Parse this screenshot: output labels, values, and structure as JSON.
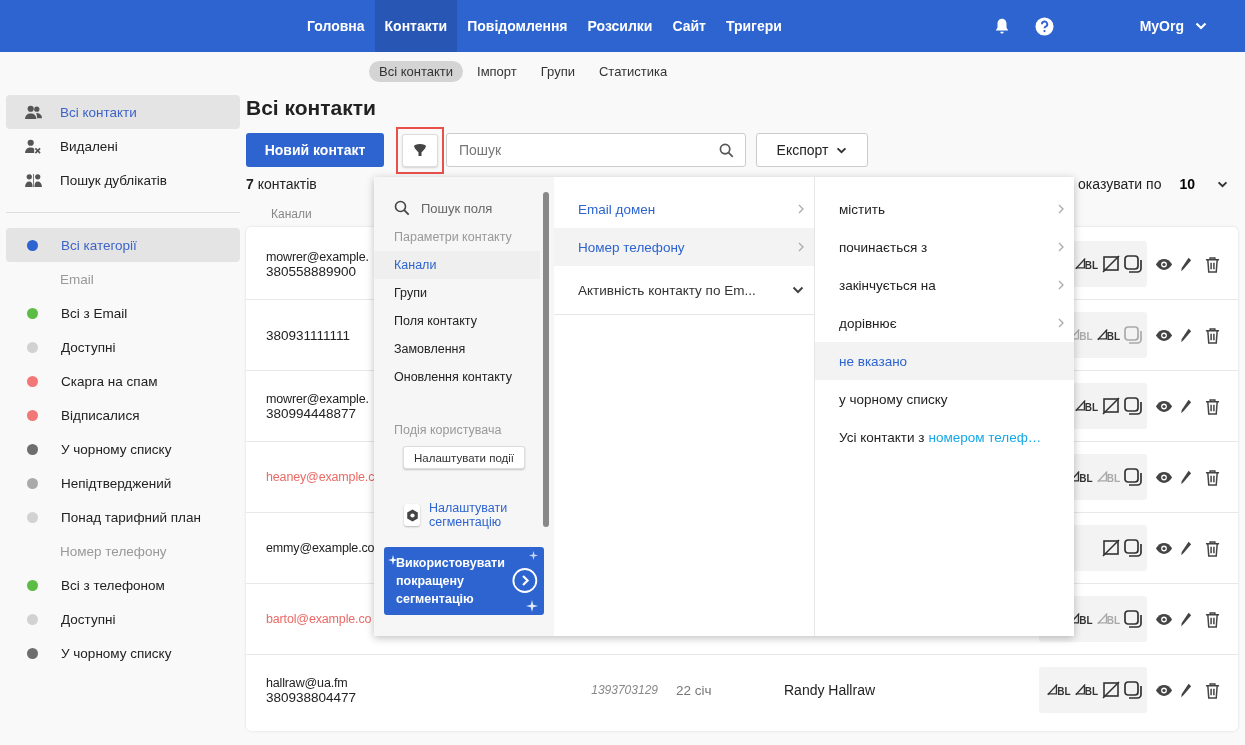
{
  "nav": {
    "items": [
      {
        "label": "Головна",
        "selected": false
      },
      {
        "label": "Контакти",
        "selected": true
      },
      {
        "label": "Повідомлення",
        "selected": false
      },
      {
        "label": "Розсилки",
        "selected": false
      },
      {
        "label": "Сайт",
        "selected": false
      },
      {
        "label": "Тригери",
        "selected": false
      }
    ],
    "org": "MyOrg"
  },
  "subnav": [
    {
      "label": "Всі контакти",
      "selected": true
    },
    {
      "label": "Імпорт",
      "selected": false
    },
    {
      "label": "Групи",
      "selected": false
    },
    {
      "label": "Статистика",
      "selected": false
    }
  ],
  "sidebar": {
    "items": [
      {
        "kind": "people",
        "label": "Всі контакти",
        "selected": true
      },
      {
        "kind": "deleted",
        "label": "Видалені",
        "selected": false
      },
      {
        "kind": "duplicates",
        "label": "Пошук дублікатів",
        "selected": false
      }
    ],
    "categories": [
      {
        "kind": "category",
        "label": "Всі категорії",
        "color": "#2d64cf",
        "selected": true
      },
      {
        "kind": "heading",
        "label": "Email"
      },
      {
        "kind": "category",
        "label": "Всі з Email",
        "color": "#5bbd45",
        "selected": false
      },
      {
        "kind": "category",
        "label": "Доступні",
        "color": "#d2d2d2",
        "selected": false
      },
      {
        "kind": "category",
        "label": "Скарга на спам",
        "color": "#f27777",
        "selected": false
      },
      {
        "kind": "category",
        "label": "Відписалися",
        "color": "#f27777",
        "selected": false
      },
      {
        "kind": "category",
        "label": "У чорному списку",
        "color": "#6e6e6e",
        "selected": false
      },
      {
        "kind": "category",
        "label": "Непідтверджений",
        "color": "#aaaaaa",
        "selected": false
      },
      {
        "kind": "category",
        "label": "Понад тарифний план",
        "color": "#d2d2d2",
        "selected": false
      },
      {
        "kind": "heading",
        "label": "Номер телефону"
      },
      {
        "kind": "category",
        "label": "Всі з телефоном",
        "color": "#5bbd45",
        "selected": false
      },
      {
        "kind": "category",
        "label": "Доступні",
        "color": "#d2d2d2",
        "selected": false
      },
      {
        "kind": "category",
        "label": "У чорному списку",
        "color": "#6e6e6e",
        "selected": false
      }
    ]
  },
  "page": {
    "title": "Всі контакти",
    "new_button": "Новий контакт",
    "filter_highlighted": true,
    "search_placeholder": "Пошук",
    "export_button": "Експорт",
    "count": "**7** контактів",
    "page_size_label": "оказувати по",
    "page_size": "10"
  },
  "table": {
    "columns": [
      "Канали"
    ],
    "rows": [
      {
        "email": "mowrer@example.",
        "email_flagged": false,
        "phone": "380558889900",
        "icons": [
          {
            "kind": "bl",
            "label": "BL",
            "enabled": true
          },
          {
            "kind": "sms",
            "enabled": true
          },
          {
            "kind": "push",
            "enabled": true
          }
        ]
      },
      {
        "phone": "380931111111",
        "icons": [
          {
            "kind": "bl",
            "label": "BL",
            "enabled": false
          },
          {
            "kind": "bl",
            "label": "BL",
            "enabled": true
          },
          {
            "kind": "push",
            "enabled": false
          }
        ]
      },
      {
        "email": "mowrer@example.",
        "email_flagged": false,
        "phone": "380994448877",
        "icons": [
          {
            "kind": "bl",
            "label": "BL",
            "enabled": true
          },
          {
            "kind": "sms",
            "enabled": true
          },
          {
            "kind": "push",
            "enabled": true
          }
        ]
      },
      {
        "email": "heaney@example.c",
        "email_flagged": true,
        "icons": [
          {
            "kind": "bl",
            "label": "BL",
            "enabled": true
          },
          {
            "kind": "bl",
            "label": "BL",
            "enabled": false
          },
          {
            "kind": "push",
            "enabled": true
          }
        ]
      },
      {
        "email": "emmy@example.co",
        "email_flagged": false,
        "icons": [
          {
            "kind": "sms",
            "enabled": true
          },
          {
            "kind": "push",
            "enabled": true
          }
        ]
      },
      {
        "email": "bartol@example.co",
        "email_flagged": true,
        "icons": [
          {
            "kind": "bl",
            "label": "BL",
            "enabled": true
          },
          {
            "kind": "bl",
            "label": "BL",
            "enabled": false
          },
          {
            "kind": "push",
            "enabled": true
          }
        ]
      },
      {
        "email": "hallraw@ua.fm",
        "email_flagged": false,
        "phone": "380938804477",
        "id": "1393703129",
        "date": "22 січ",
        "name": "Randy Hallraw",
        "icons": [
          {
            "kind": "bl",
            "label": "BL",
            "enabled": true
          },
          {
            "kind": "bl",
            "label": "BL",
            "enabled": true
          },
          {
            "kind": "sms",
            "enabled": true
          },
          {
            "kind": "push",
            "enabled": true
          }
        ]
      }
    ]
  },
  "filter_menu": {
    "search_placeholder": "Пошук поля",
    "section_title": "Параметри контакту",
    "items": [
      {
        "label": "Канали",
        "selected": true
      },
      {
        "label": "Групи",
        "selected": false
      },
      {
        "label": "Поля контакту",
        "selected": false
      },
      {
        "label": "Замовлення",
        "selected": false
      },
      {
        "label": "Оновлення контакту",
        "selected": false
      }
    ],
    "events_title": "Подія користувача",
    "events_button": "Налаштувати події",
    "settings_link": "Налаштувати сегментацію",
    "promo": "Використовувати покращену сегментацію",
    "fields": [
      {
        "kind": "field",
        "label": "Email домен",
        "selected": false
      },
      {
        "kind": "field",
        "label": "Номер телефону",
        "selected": true
      },
      {
        "kind": "group",
        "label": "Активність контакту по Em...",
        "selected": false
      }
    ],
    "conditions": [
      {
        "kind": "submenu",
        "label": "містить",
        "selected": false
      },
      {
        "kind": "submenu",
        "label": "починається з",
        "selected": false
      },
      {
        "kind": "submenu",
        "label": "закінчується на",
        "selected": false
      },
      {
        "kind": "submenu",
        "label": "дорівнює",
        "selected": false
      },
      {
        "kind": "plain",
        "label": "не вказано",
        "selected": true
      },
      {
        "kind": "plain",
        "label": "у чорному списку",
        "selected": false
      },
      {
        "kind": "link",
        "label": "Усі контакти з",
        "link": "номером телеф…",
        "selected": false
      }
    ]
  }
}
